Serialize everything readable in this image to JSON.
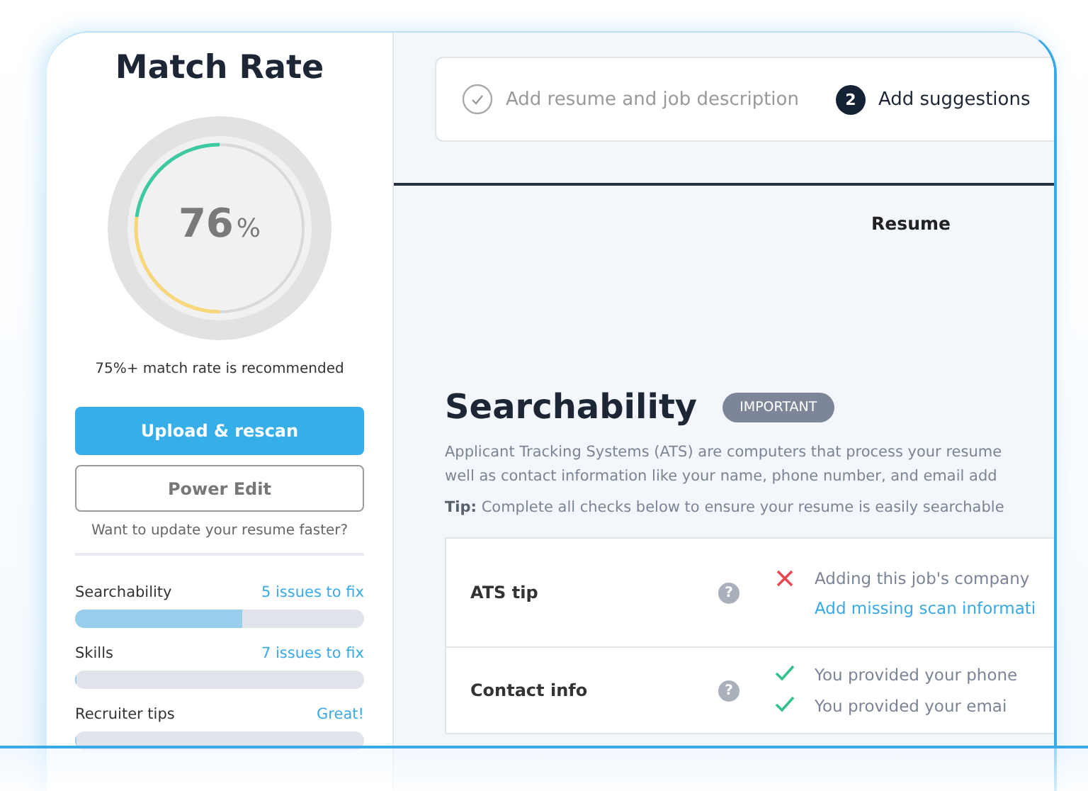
{
  "sidebar": {
    "title": "Match Rate",
    "score": {
      "value": "76",
      "unit": "%"
    },
    "hint": "75%+ match rate is recommended",
    "buttons": [
      {
        "label": "Upload & rescan",
        "kind": "primary"
      },
      {
        "label": "Power Edit",
        "kind": "outline"
      }
    ],
    "note": "Want to update your resume faster?",
    "categories": [
      {
        "name": "Searchability",
        "status": "5 issues to fix",
        "level": 0.58
      },
      {
        "name": "Skills",
        "status": "7 issues to fix",
        "level": 0
      },
      {
        "name": "Recruiter tips",
        "status": "Great!",
        "level": 0
      }
    ]
  },
  "steps": [
    {
      "label": "Add resume and job description",
      "done": true
    },
    {
      "number": "2",
      "label": "Add suggestions",
      "done": false
    }
  ],
  "tab": "Resume",
  "section": {
    "title": "Searchability",
    "badge": "IMPORTANT",
    "description": [
      "Applicant Tracking Systems (ATS) are computers that process your resume",
      "well as contact information like your name, phone number, and email add"
    ],
    "tip": "**Tip:** Complete all checks below to ensure your resume is easily searchable",
    "checks": [
      {
        "label": "ATS tip",
        "help": "?",
        "items": [
          {
            "kind": "fail",
            "text": "Adding this job's company",
            "link": "Add missing scan informati"
          }
        ]
      },
      {
        "label": "Contact info",
        "help": "?",
        "items": [
          {
            "kind": "pass",
            "text": "You provided your phone"
          },
          {
            "kind": "pass",
            "text": "You provided your emai"
          }
        ]
      }
    ]
  }
}
